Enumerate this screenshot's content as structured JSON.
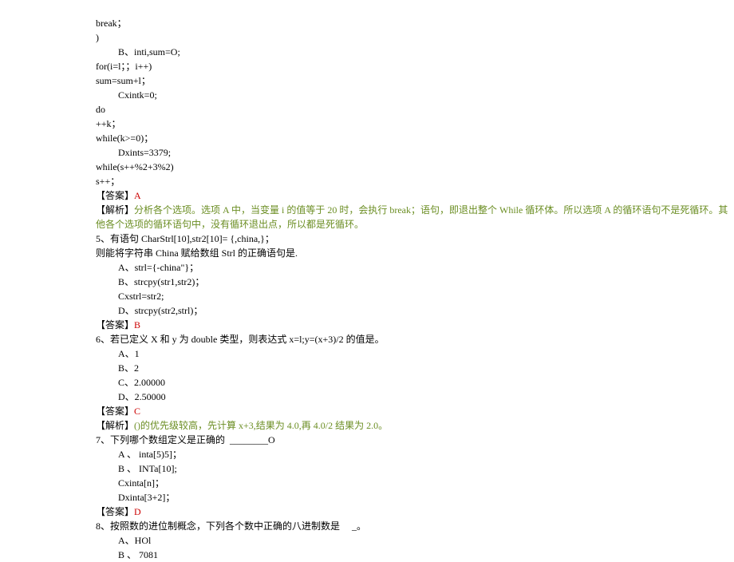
{
  "lines": {
    "l1": "break；",
    "l2": ")",
    "l3": "B、inti,sum=O;",
    "l4": "for(i=l；；i++)",
    "l5": "sum=sum+l；",
    "l6": "Cxintk=0;",
    "l7": "do",
    "l8": "++k；",
    "l9": "while(k>=0)；",
    "l10": "Dxints=3379;",
    "l11": "while(s++%2+3%2)",
    "l12": "s++；",
    "ans1_label": "【答案】",
    "ans1_val": "A",
    "ana1_label": "【解析】",
    "ana1_text": "分析各个选项。选项 A 中，当变量 i 的值等于 20 时，会执行 break；语句，即退出整个 While 循环体。所以选项 A 的循环语句不是死循环。其他各个选项的循环语句中，没有循环退出点，所以都是死循环。",
    "q5_1": "5、有语句 CharStrl[10],str2[10]= {,china,}；",
    "q5_2": "则能将字符串 China 赋给数组 Strl 的正确语句是.",
    "q5_a": "A、strl={-china\"}；",
    "q5_b": "B、strcpy(str1,str2)；",
    "q5_c": "Cxstrl=str2;",
    "q5_d": "D、strcpy(str2,strl)；",
    "ans2_label": "【答案】",
    "ans2_val": "B",
    "q6_1": "6、若已定义 X 和 y 为 double 类型，则表达式 x=l;y=(x+3)/2 的值是。",
    "q6_a": "A、1",
    "q6_b": "B、2",
    "q6_c": "C、2.00000",
    "q6_d": "D、2.50000",
    "ans3_label": "【答案】",
    "ans3_val": "C",
    "ana3_label": "【解析】",
    "ana3_text": "()的优先级较高，先计算 x+3,结果为 4.0,再 4.0/2 结果为 2.0。",
    "q7_1": "7、下列哪个数组定义是正确的  ________O",
    "q7_a": "A 、 inta[5)5]；",
    "q7_b": "B 、 INTa[10];",
    "q7_c": "Cxinta[n]；",
    "q7_d": "Dxinta[3+2]；",
    "ans4_label": "【答案】",
    "ans4_val": "D",
    "q8_1": "8、按照数的进位制概念，下列各个数中正确的八进制数是     _。",
    "q8_a": "A、HOl",
    "q8_b": "B 、 7081"
  }
}
